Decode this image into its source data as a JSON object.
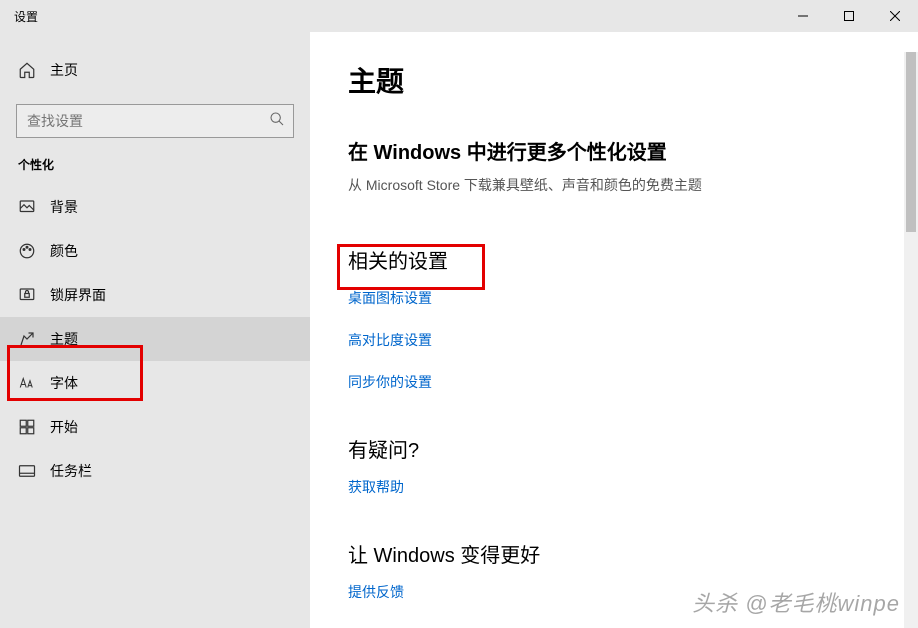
{
  "titlebar": {
    "title": "设置"
  },
  "sidebar": {
    "home": "主页",
    "search_placeholder": "查找设置",
    "category": "个性化",
    "items": [
      {
        "label": "背景"
      },
      {
        "label": "颜色"
      },
      {
        "label": "锁屏界面"
      },
      {
        "label": "主题"
      },
      {
        "label": "字体"
      },
      {
        "label": "开始"
      },
      {
        "label": "任务栏"
      }
    ]
  },
  "content": {
    "title": "主题",
    "more_title": "在 Windows 中进行更多个性化设置",
    "more_sub": "从 Microsoft Store 下载兼具壁纸、声音和颜色的免费主题",
    "related_title": "相关的设置",
    "related_links": [
      "桌面图标设置",
      "高对比度设置",
      "同步你的设置"
    ],
    "help_title": "有疑问?",
    "help_link": "获取帮助",
    "feedback_title": "让 Windows 变得更好",
    "feedback_link": "提供反馈"
  },
  "watermark": "头杀 @老毛桃winpe"
}
